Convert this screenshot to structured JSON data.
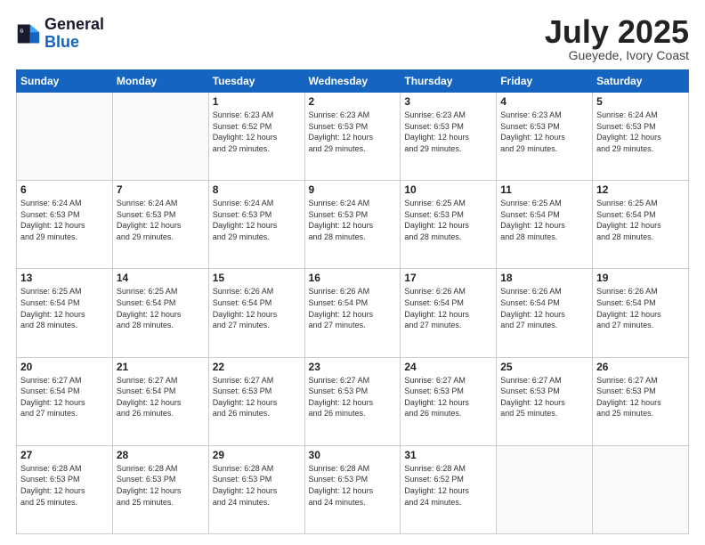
{
  "header": {
    "logo_general": "General",
    "logo_blue": "Blue",
    "month_title": "July 2025",
    "location": "Gueyede, Ivory Coast"
  },
  "days_of_week": [
    "Sunday",
    "Monday",
    "Tuesday",
    "Wednesday",
    "Thursday",
    "Friday",
    "Saturday"
  ],
  "weeks": [
    [
      {
        "day": "",
        "empty": true
      },
      {
        "day": "",
        "empty": true
      },
      {
        "day": "1",
        "sunrise": "6:23 AM",
        "sunset": "6:52 PM",
        "daylight": "12 hours and 29 minutes."
      },
      {
        "day": "2",
        "sunrise": "6:23 AM",
        "sunset": "6:53 PM",
        "daylight": "12 hours and 29 minutes."
      },
      {
        "day": "3",
        "sunrise": "6:23 AM",
        "sunset": "6:53 PM",
        "daylight": "12 hours and 29 minutes."
      },
      {
        "day": "4",
        "sunrise": "6:23 AM",
        "sunset": "6:53 PM",
        "daylight": "12 hours and 29 minutes."
      },
      {
        "day": "5",
        "sunrise": "6:24 AM",
        "sunset": "6:53 PM",
        "daylight": "12 hours and 29 minutes."
      }
    ],
    [
      {
        "day": "6",
        "sunrise": "6:24 AM",
        "sunset": "6:53 PM",
        "daylight": "12 hours and 29 minutes."
      },
      {
        "day": "7",
        "sunrise": "6:24 AM",
        "sunset": "6:53 PM",
        "daylight": "12 hours and 29 minutes."
      },
      {
        "day": "8",
        "sunrise": "6:24 AM",
        "sunset": "6:53 PM",
        "daylight": "12 hours and 29 minutes."
      },
      {
        "day": "9",
        "sunrise": "6:24 AM",
        "sunset": "6:53 PM",
        "daylight": "12 hours and 28 minutes."
      },
      {
        "day": "10",
        "sunrise": "6:25 AM",
        "sunset": "6:53 PM",
        "daylight": "12 hours and 28 minutes."
      },
      {
        "day": "11",
        "sunrise": "6:25 AM",
        "sunset": "6:54 PM",
        "daylight": "12 hours and 28 minutes."
      },
      {
        "day": "12",
        "sunrise": "6:25 AM",
        "sunset": "6:54 PM",
        "daylight": "12 hours and 28 minutes."
      }
    ],
    [
      {
        "day": "13",
        "sunrise": "6:25 AM",
        "sunset": "6:54 PM",
        "daylight": "12 hours and 28 minutes."
      },
      {
        "day": "14",
        "sunrise": "6:25 AM",
        "sunset": "6:54 PM",
        "daylight": "12 hours and 28 minutes."
      },
      {
        "day": "15",
        "sunrise": "6:26 AM",
        "sunset": "6:54 PM",
        "daylight": "12 hours and 27 minutes."
      },
      {
        "day": "16",
        "sunrise": "6:26 AM",
        "sunset": "6:54 PM",
        "daylight": "12 hours and 27 minutes."
      },
      {
        "day": "17",
        "sunrise": "6:26 AM",
        "sunset": "6:54 PM",
        "daylight": "12 hours and 27 minutes."
      },
      {
        "day": "18",
        "sunrise": "6:26 AM",
        "sunset": "6:54 PM",
        "daylight": "12 hours and 27 minutes."
      },
      {
        "day": "19",
        "sunrise": "6:26 AM",
        "sunset": "6:54 PM",
        "daylight": "12 hours and 27 minutes."
      }
    ],
    [
      {
        "day": "20",
        "sunrise": "6:27 AM",
        "sunset": "6:54 PM",
        "daylight": "12 hours and 27 minutes."
      },
      {
        "day": "21",
        "sunrise": "6:27 AM",
        "sunset": "6:54 PM",
        "daylight": "12 hours and 26 minutes."
      },
      {
        "day": "22",
        "sunrise": "6:27 AM",
        "sunset": "6:53 PM",
        "daylight": "12 hours and 26 minutes."
      },
      {
        "day": "23",
        "sunrise": "6:27 AM",
        "sunset": "6:53 PM",
        "daylight": "12 hours and 26 minutes."
      },
      {
        "day": "24",
        "sunrise": "6:27 AM",
        "sunset": "6:53 PM",
        "daylight": "12 hours and 26 minutes."
      },
      {
        "day": "25",
        "sunrise": "6:27 AM",
        "sunset": "6:53 PM",
        "daylight": "12 hours and 25 minutes."
      },
      {
        "day": "26",
        "sunrise": "6:27 AM",
        "sunset": "6:53 PM",
        "daylight": "12 hours and 25 minutes."
      }
    ],
    [
      {
        "day": "27",
        "sunrise": "6:28 AM",
        "sunset": "6:53 PM",
        "daylight": "12 hours and 25 minutes."
      },
      {
        "day": "28",
        "sunrise": "6:28 AM",
        "sunset": "6:53 PM",
        "daylight": "12 hours and 25 minutes."
      },
      {
        "day": "29",
        "sunrise": "6:28 AM",
        "sunset": "6:53 PM",
        "daylight": "12 hours and 24 minutes."
      },
      {
        "day": "30",
        "sunrise": "6:28 AM",
        "sunset": "6:53 PM",
        "daylight": "12 hours and 24 minutes."
      },
      {
        "day": "31",
        "sunrise": "6:28 AM",
        "sunset": "6:52 PM",
        "daylight": "12 hours and 24 minutes."
      },
      {
        "day": "",
        "empty": true
      },
      {
        "day": "",
        "empty": true
      }
    ]
  ],
  "labels": {
    "sunrise": "Sunrise:",
    "sunset": "Sunset:",
    "daylight": "Daylight:"
  }
}
